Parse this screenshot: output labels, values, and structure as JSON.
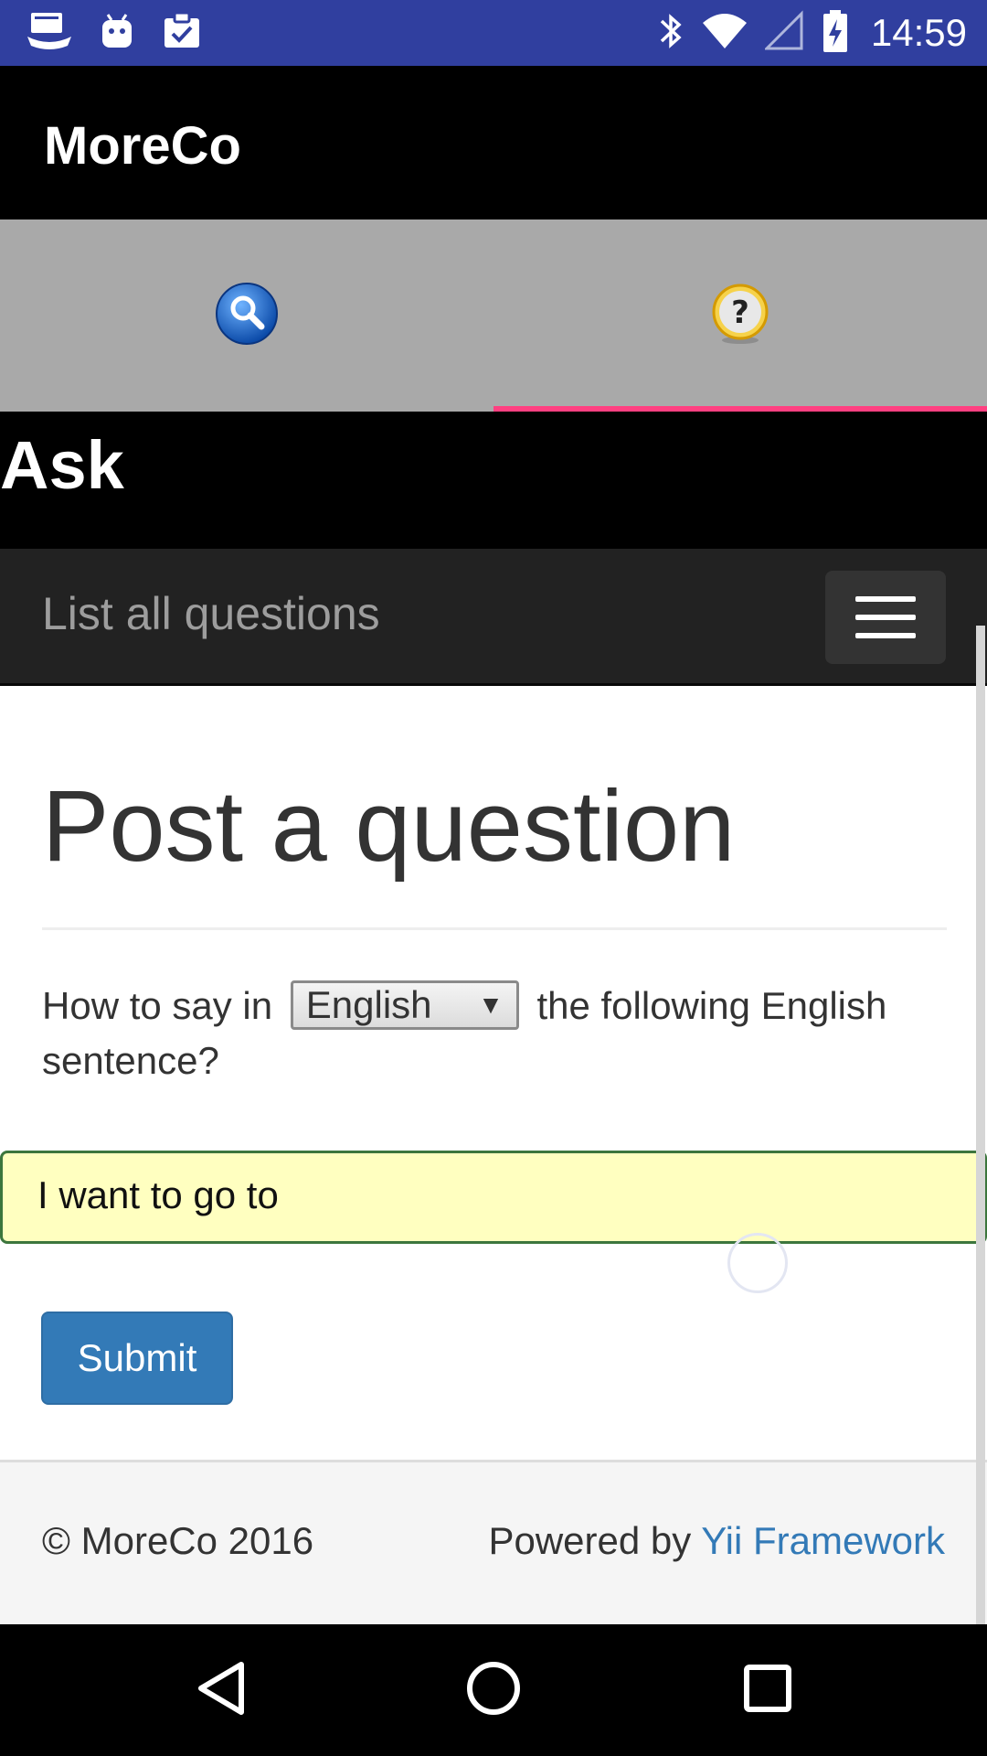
{
  "status_bar": {
    "time": "14:59",
    "left_icons": [
      "ship-icon",
      "android-icon",
      "clipboard-check-icon"
    ],
    "right_icons": [
      "bluetooth-icon",
      "wifi-icon",
      "cell-signal-icon",
      "battery-charging-icon"
    ]
  },
  "app_bar": {
    "title": "MoreCo"
  },
  "tabs": [
    {
      "icon": "search-icon",
      "active": false
    },
    {
      "icon": "help-icon",
      "active": true
    }
  ],
  "page_header": {
    "title": "Ask"
  },
  "navbar": {
    "brand": "List all questions",
    "toggle_icon": "hamburger-icon"
  },
  "main": {
    "title": "Post a question",
    "question_prefix": "How to say in",
    "question_suffix": "the following English sentence?",
    "language_select": {
      "value": "English"
    },
    "sentence_input": {
      "value": "I want to go to"
    },
    "submit_label": "Submit"
  },
  "footer": {
    "copyright": "© MoreCo 2016",
    "powered_prefix": "Powered by",
    "powered_link": "Yii Framework"
  },
  "colors": {
    "status_bar": "#303f9f",
    "tab_indicator": "#ff4081",
    "primary_button": "#337ab7",
    "input_background": "#ffffc0",
    "input_border": "#3c763d"
  },
  "system_nav": [
    "back-icon",
    "home-icon",
    "recents-icon"
  ]
}
